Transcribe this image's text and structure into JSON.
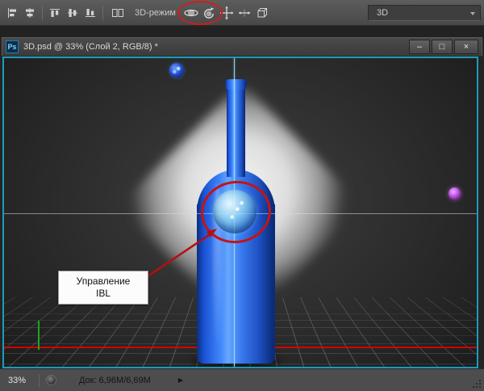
{
  "toolbar": {
    "mode_label": "3D-режим",
    "workspace": "3D"
  },
  "doc": {
    "badge": "Ps",
    "title": "3D.psd @ 33% (Слой 2, RGB/8) *",
    "minimize_glyph": "–",
    "maximize_glyph": "□",
    "close_glyph": "×"
  },
  "canvas": {
    "callout_line1": "Управление",
    "callout_line2": "IBL"
  },
  "status": {
    "zoom": "33%",
    "doc_info": "Док: 6,96M/6,69M",
    "flyout_glyph": "▶"
  },
  "colors": {
    "canvas_border": "#1a9cba",
    "annotation_red": "#c41414",
    "bottle_blue": "#2f6ef0",
    "axis_red": "#d40000",
    "axis_green": "#1ca81c",
    "widget_purple": "#b044d8"
  }
}
